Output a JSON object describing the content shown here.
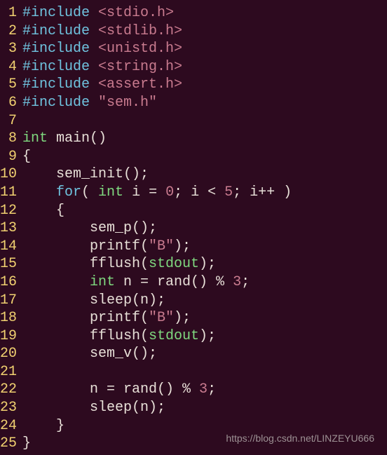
{
  "lines": [
    {
      "n": "1",
      "tokens": [
        {
          "c": "pp",
          "t": "#include"
        },
        {
          "c": "op",
          "t": " "
        },
        {
          "c": "str",
          "t": "<stdio.h>"
        }
      ]
    },
    {
      "n": "2",
      "tokens": [
        {
          "c": "pp",
          "t": "#include"
        },
        {
          "c": "op",
          "t": " "
        },
        {
          "c": "str",
          "t": "<stdlib.h>"
        }
      ]
    },
    {
      "n": "3",
      "tokens": [
        {
          "c": "pp",
          "t": "#include"
        },
        {
          "c": "op",
          "t": " "
        },
        {
          "c": "str",
          "t": "<unistd.h>"
        }
      ]
    },
    {
      "n": "4",
      "tokens": [
        {
          "c": "pp",
          "t": "#include"
        },
        {
          "c": "op",
          "t": " "
        },
        {
          "c": "str",
          "t": "<string.h>"
        }
      ]
    },
    {
      "n": "5",
      "tokens": [
        {
          "c": "pp",
          "t": "#include"
        },
        {
          "c": "op",
          "t": " "
        },
        {
          "c": "str",
          "t": "<assert.h>"
        }
      ]
    },
    {
      "n": "6",
      "tokens": [
        {
          "c": "pp",
          "t": "#include"
        },
        {
          "c": "op",
          "t": " "
        },
        {
          "c": "str",
          "t": "\"sem.h\""
        }
      ]
    },
    {
      "n": "7",
      "tokens": []
    },
    {
      "n": "8",
      "tokens": [
        {
          "c": "type",
          "t": "int"
        },
        {
          "c": "op",
          "t": " "
        },
        {
          "c": "fn",
          "t": "main()"
        }
      ]
    },
    {
      "n": "9",
      "tokens": [
        {
          "c": "op",
          "t": "{"
        }
      ]
    },
    {
      "n": "10",
      "tokens": [
        {
          "c": "op",
          "t": "    "
        },
        {
          "c": "fn",
          "t": "sem_init();"
        }
      ]
    },
    {
      "n": "11",
      "tokens": [
        {
          "c": "op",
          "t": "    "
        },
        {
          "c": "kw",
          "t": "for"
        },
        {
          "c": "op",
          "t": "( "
        },
        {
          "c": "type",
          "t": "int"
        },
        {
          "c": "op",
          "t": " i = "
        },
        {
          "c": "num",
          "t": "0"
        },
        {
          "c": "op",
          "t": "; i < "
        },
        {
          "c": "num",
          "t": "5"
        },
        {
          "c": "op",
          "t": "; i++ )"
        }
      ]
    },
    {
      "n": "12",
      "tokens": [
        {
          "c": "op",
          "t": "    {"
        }
      ]
    },
    {
      "n": "13",
      "tokens": [
        {
          "c": "op",
          "t": "        sem_p();"
        }
      ]
    },
    {
      "n": "14",
      "tokens": [
        {
          "c": "op",
          "t": "        printf("
        },
        {
          "c": "str",
          "t": "\"B\""
        },
        {
          "c": "op",
          "t": ");"
        }
      ]
    },
    {
      "n": "15",
      "tokens": [
        {
          "c": "op",
          "t": "        fflush("
        },
        {
          "c": "stdout",
          "t": "stdout"
        },
        {
          "c": "op",
          "t": ");"
        }
      ]
    },
    {
      "n": "16",
      "tokens": [
        {
          "c": "op",
          "t": "        "
        },
        {
          "c": "type",
          "t": "int"
        },
        {
          "c": "op",
          "t": " n = rand() % "
        },
        {
          "c": "num",
          "t": "3"
        },
        {
          "c": "op",
          "t": ";"
        }
      ]
    },
    {
      "n": "17",
      "tokens": [
        {
          "c": "op",
          "t": "        sleep(n);"
        }
      ]
    },
    {
      "n": "18",
      "tokens": [
        {
          "c": "op",
          "t": "        printf("
        },
        {
          "c": "str",
          "t": "\"B\""
        },
        {
          "c": "op",
          "t": ");"
        }
      ]
    },
    {
      "n": "19",
      "tokens": [
        {
          "c": "op",
          "t": "        fflush("
        },
        {
          "c": "stdout",
          "t": "stdout"
        },
        {
          "c": "op",
          "t": ");"
        }
      ]
    },
    {
      "n": "20",
      "tokens": [
        {
          "c": "op",
          "t": "        sem_v();"
        }
      ]
    },
    {
      "n": "21",
      "tokens": []
    },
    {
      "n": "22",
      "tokens": [
        {
          "c": "op",
          "t": "        n = rand() % "
        },
        {
          "c": "num",
          "t": "3"
        },
        {
          "c": "op",
          "t": ";"
        }
      ]
    },
    {
      "n": "23",
      "tokens": [
        {
          "c": "op",
          "t": "        sleep(n);"
        }
      ]
    },
    {
      "n": "24",
      "tokens": [
        {
          "c": "op",
          "t": "    }"
        }
      ]
    },
    {
      "n": "25",
      "tokens": [
        {
          "c": "op",
          "t": "}"
        }
      ]
    }
  ],
  "watermark": "https://blog.csdn.net/LINZEYU666"
}
